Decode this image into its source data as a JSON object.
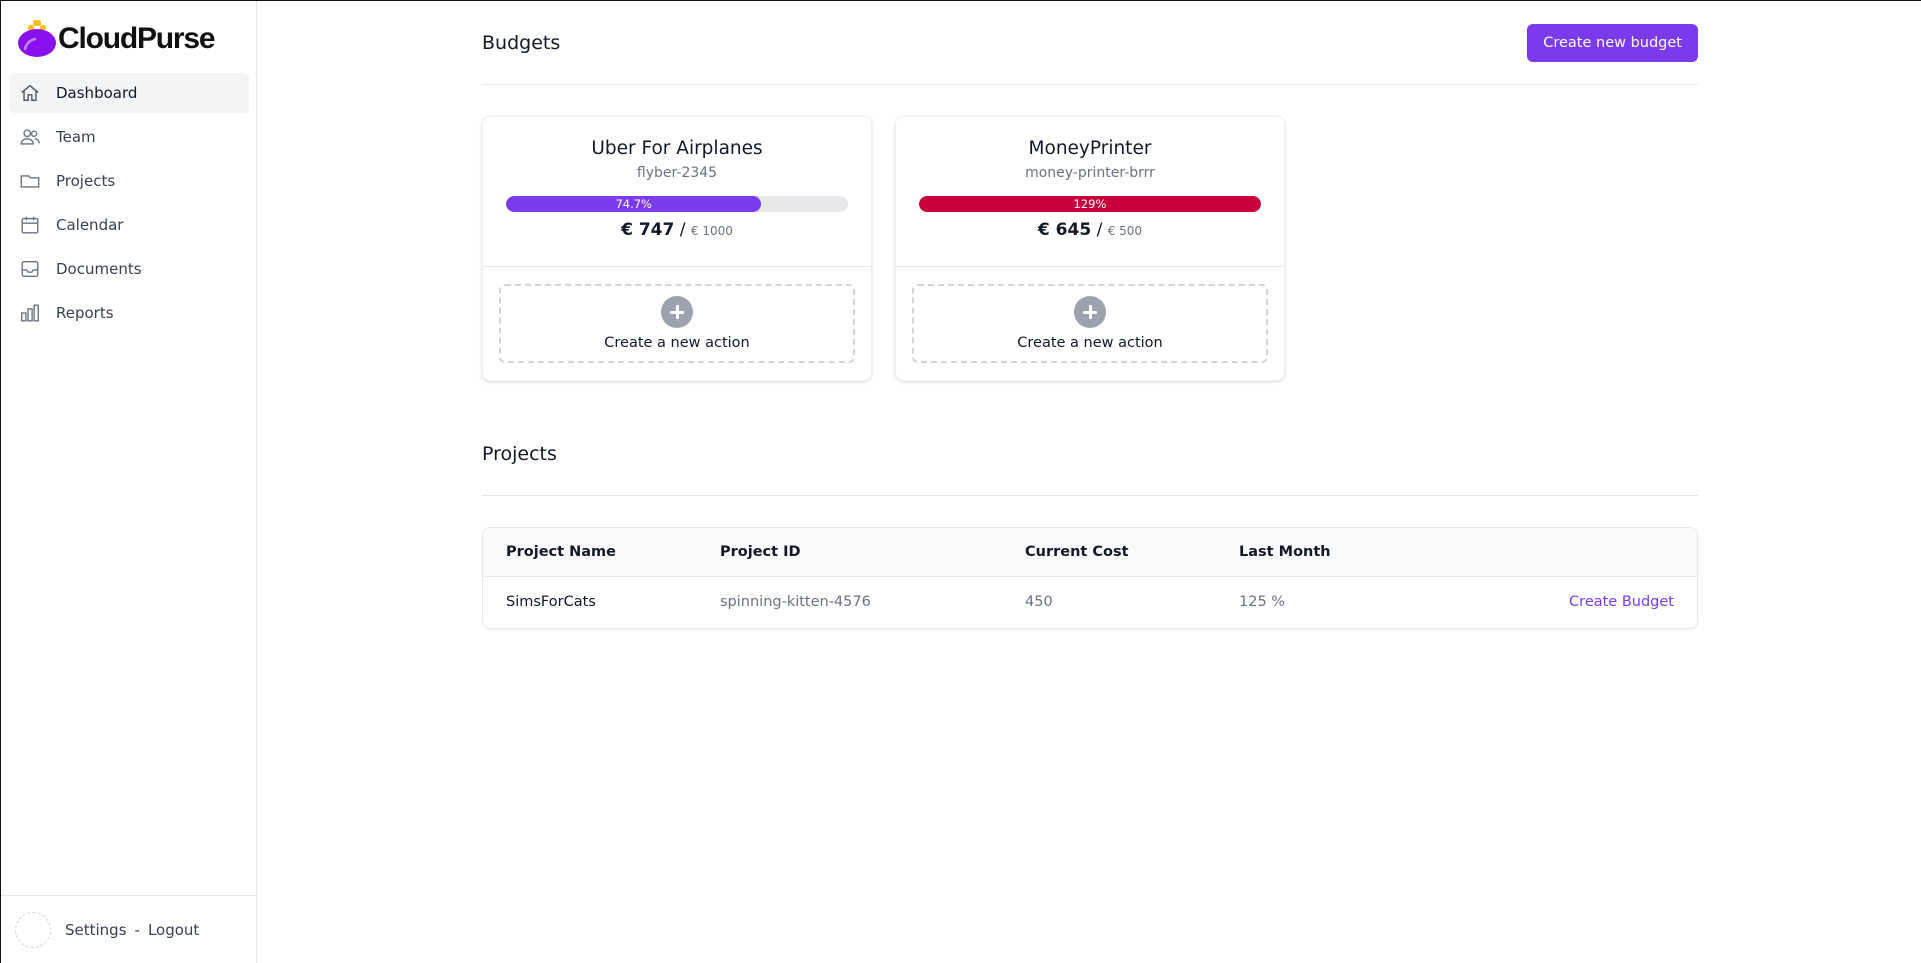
{
  "app": {
    "name": "CloudPurse"
  },
  "sidebar": {
    "items": [
      {
        "label": "Dashboard",
        "icon": "home-icon"
      },
      {
        "label": "Team",
        "icon": "users-icon"
      },
      {
        "label": "Projects",
        "icon": "folder-icon"
      },
      {
        "label": "Calendar",
        "icon": "calendar-icon"
      },
      {
        "label": "Documents",
        "icon": "inbox-icon"
      },
      {
        "label": "Reports",
        "icon": "chart-bar-icon"
      }
    ],
    "active": "Dashboard",
    "footer": {
      "settings": "Settings",
      "separator": "-",
      "logout": "Logout"
    }
  },
  "budgets": {
    "title": "Budgets",
    "create_button": "Create new budget",
    "cards": [
      {
        "title": "Uber For Airplanes",
        "project_id": "flyber-2345",
        "progress_label": "74.7%",
        "progress_fraction": 0.747,
        "bar_color": "#7c3aed",
        "current": "€ 747",
        "separator": "/",
        "limit": "€ 1000",
        "action_label": "Create a new action"
      },
      {
        "title": "MoneyPrinter",
        "project_id": "money-printer-brrr",
        "progress_label": "129%",
        "progress_fraction": 1.0,
        "bar_color": "#c8003c",
        "current": "€ 645",
        "separator": "/",
        "limit": "€ 500",
        "action_label": "Create a new action"
      }
    ]
  },
  "projects": {
    "title": "Projects",
    "columns": [
      "Project Name",
      "Project ID",
      "Current Cost",
      "Last Month",
      ""
    ],
    "rows": [
      {
        "name": "SimsForCats",
        "id": "spinning-kitten-4576",
        "cost": "450",
        "last_month": "125 %",
        "action": "Create Budget"
      }
    ]
  },
  "colors": {
    "accent": "#7c3aed",
    "danger": "#c8003c"
  }
}
